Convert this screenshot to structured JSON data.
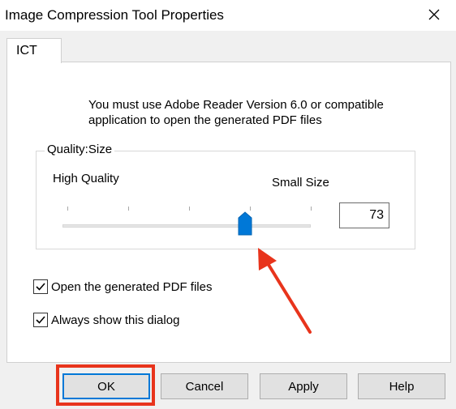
{
  "window": {
    "title": "Image Compression Tool Properties",
    "close_icon": "close-icon"
  },
  "tab": {
    "label": "ICT"
  },
  "info": {
    "line1": "You must use Adobe Reader Version 6.0 or compatible",
    "line2": "application to open the generated PDF files"
  },
  "quality": {
    "group_title": "Quality:Size",
    "high_label": "High Quality",
    "small_label": "Small Size",
    "slider": {
      "min": 0,
      "max": 100,
      "value": 73,
      "ticks": [
        0,
        25,
        50,
        75,
        100
      ]
    },
    "value_text": "73"
  },
  "options": [
    {
      "label": "Open the generated PDF files",
      "checked": true
    },
    {
      "label": "Always show this dialog",
      "checked": true
    }
  ],
  "buttons": {
    "ok": "OK",
    "cancel": "Cancel",
    "apply": "Apply",
    "help": "Help"
  },
  "colors": {
    "accent": "#0078d7",
    "annotation": "#e8341c"
  }
}
